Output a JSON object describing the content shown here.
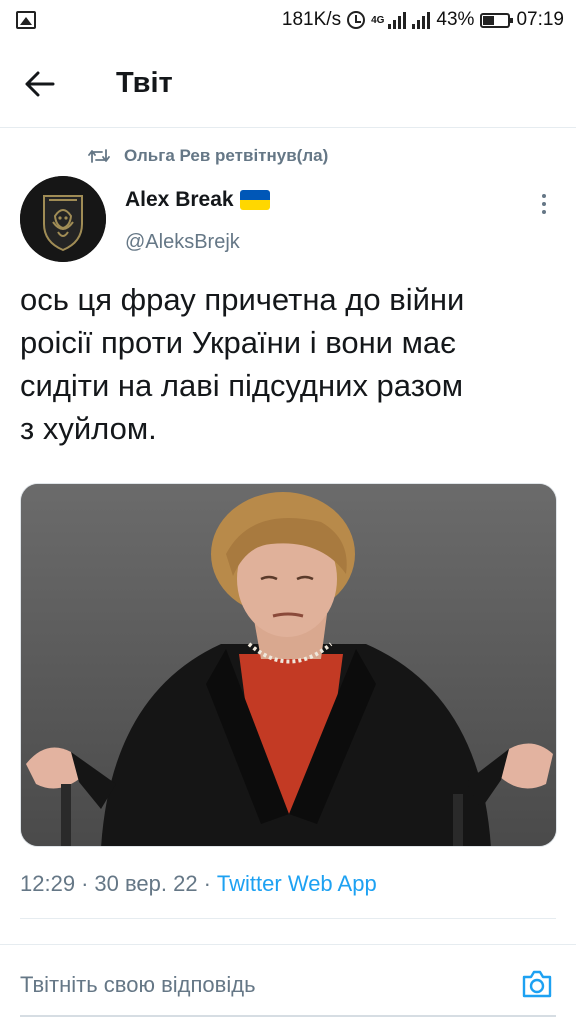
{
  "status_bar": {
    "speed": "181K/s",
    "network": "4G",
    "battery": "43%",
    "time": "07:19"
  },
  "header": {
    "title": "Твіт",
    "back_icon": "arrow-left-icon"
  },
  "retweet_context": {
    "text": "Ольга Рев ретвітнув(ла)",
    "icon": "retweet-icon"
  },
  "tweet": {
    "author_name": "Alex Break",
    "author_handle": "@AleksBrejk",
    "text": "ось ця фрау причетна до війни\nроісії проти України і вони має\nсидіти на лаві підсудних разом\nз хуйлом.",
    "time": "12:29",
    "date": "30 вер. 22",
    "source": "Twitter Web App"
  },
  "reply": {
    "placeholder": "Твітніть свою відповідь",
    "camera_icon": "camera-icon"
  },
  "colors": {
    "accent": "#1da1f2",
    "secondary_text": "#657786",
    "divider": "#e6ecf0",
    "flag_blue": "#0057b7",
    "flag_yellow": "#ffd700"
  }
}
